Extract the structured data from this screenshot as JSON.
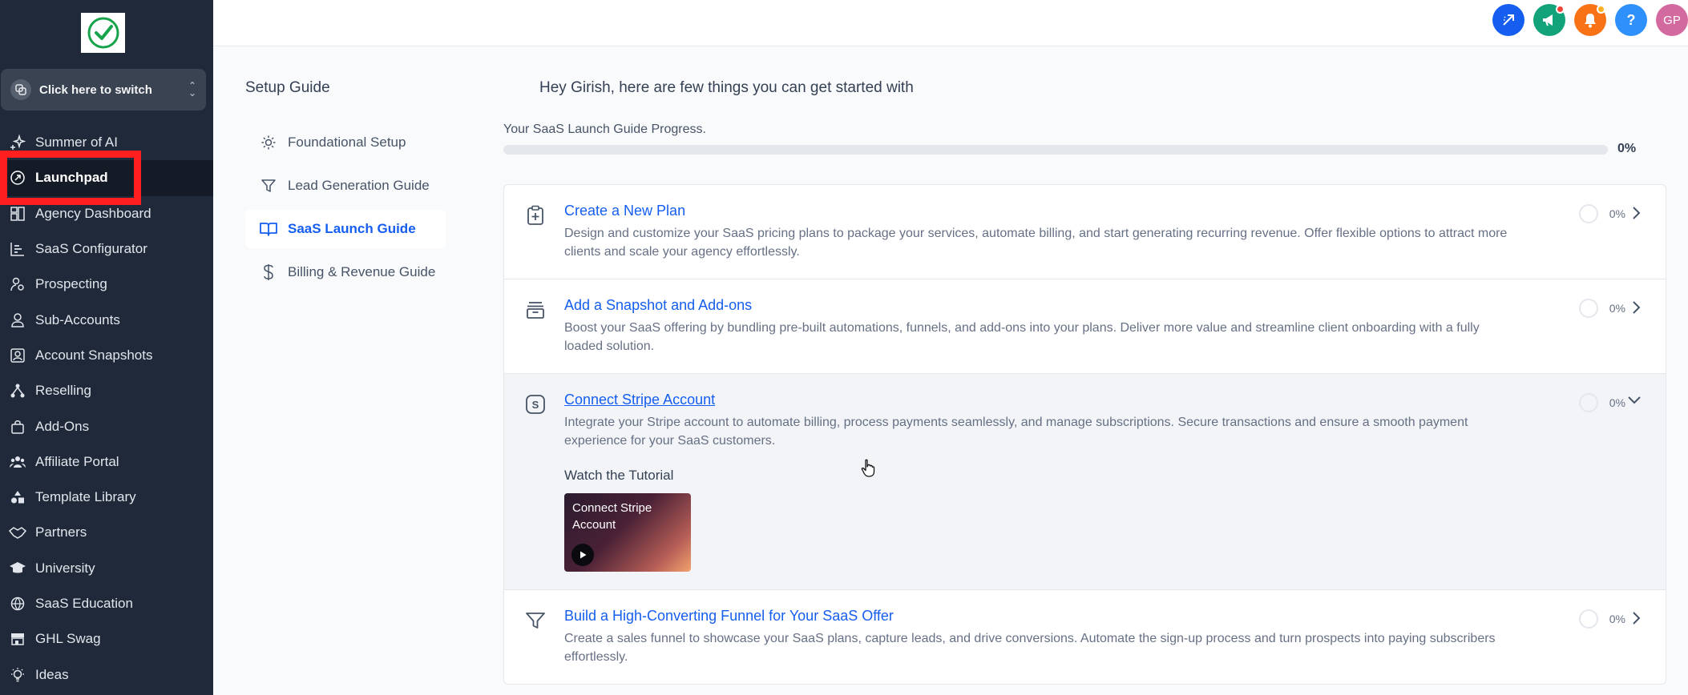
{
  "sidebar": {
    "switcher_label": "Click here to switch",
    "items": [
      {
        "label": "Summer of AI",
        "icon": "sparkle-icon"
      },
      {
        "label": "Launchpad",
        "icon": "rocket-icon",
        "active": true
      },
      {
        "label": "Agency Dashboard",
        "icon": "dashboard-icon"
      },
      {
        "label": "SaaS Configurator",
        "icon": "chart-bars-icon"
      },
      {
        "label": "Prospecting",
        "icon": "users-search-icon"
      },
      {
        "label": "Sub-Accounts",
        "icon": "user-icon"
      },
      {
        "label": "Account Snapshots",
        "icon": "snapshot-icon"
      },
      {
        "label": "Reselling",
        "icon": "network-icon"
      },
      {
        "label": "Add-Ons",
        "icon": "bag-icon"
      },
      {
        "label": "Affiliate Portal",
        "icon": "group-icon"
      },
      {
        "label": "Template Library",
        "icon": "shapes-icon"
      },
      {
        "label": "Partners",
        "icon": "handshake-icon"
      },
      {
        "label": "University",
        "icon": "graduation-cap-icon"
      },
      {
        "label": "SaaS Education",
        "icon": "globe-icon"
      },
      {
        "label": "GHL Swag",
        "icon": "store-icon"
      },
      {
        "label": "Ideas",
        "icon": "bulb-icon"
      }
    ]
  },
  "topbar": {
    "icons": [
      {
        "name": "quick-action-icon",
        "color": "#155eef"
      },
      {
        "name": "megaphone-icon",
        "color": "#12a37a",
        "badge": true
      },
      {
        "name": "bell-icon",
        "color": "#f97316",
        "badge": true
      },
      {
        "name": "help-icon",
        "color": "#2e90fa",
        "glyph": "?"
      },
      {
        "name": "avatar",
        "color": "#d36a9f",
        "text": "GP"
      }
    ]
  },
  "guide": {
    "title": "Setup Guide",
    "items": [
      {
        "label": "Foundational Setup",
        "icon": "sun-icon"
      },
      {
        "label": "Lead Generation Guide",
        "icon": "filter-icon"
      },
      {
        "label": "SaaS Launch Guide",
        "icon": "book-icon",
        "active": true
      },
      {
        "label": "Billing & Revenue Guide",
        "icon": "dollar-icon"
      }
    ]
  },
  "main": {
    "greeting": "Hey Girish, here are few things you can get started with",
    "progress_label": "Your SaaS Launch Guide Progress.",
    "progress_value": 0,
    "progress_pct": "0%",
    "cards": [
      {
        "title": "Create a New Plan",
        "desc": "Design and customize your SaaS pricing plans to package your services, automate billing, and start generating recurring revenue. Offer flexible options to attract more clients and scale your agency effortlessly.",
        "pct": "0%",
        "icon": "clipboard-plus-icon"
      },
      {
        "title": "Add a Snapshot and Add-ons",
        "desc": "Boost your SaaS offering by bundling pre-built automations, funnels, and add-ons into your plans. Deliver more value and streamline client onboarding with a fully loaded solution.",
        "pct": "0%",
        "icon": "archive-icon"
      },
      {
        "title": "Connect Stripe Account",
        "desc": "Integrate your Stripe account to automate billing, process payments seamlessly, and manage subscriptions. Secure transactions and ensure a smooth payment experience for your SaaS customers.",
        "pct": "0%",
        "icon": "stripe-icon",
        "expanded": true,
        "tutorial_label": "Watch the Tutorial",
        "tutorial_title": "Connect Stripe Account"
      },
      {
        "title": "Build a High-Converting Funnel for Your SaaS Offer",
        "desc": "Create a sales funnel to showcase your SaaS plans, capture leads, and drive conversions. Automate the sign-up process and turn prospects into paying subscribers effortlessly.",
        "pct": "0%",
        "icon": "funnel-icon"
      }
    ]
  }
}
